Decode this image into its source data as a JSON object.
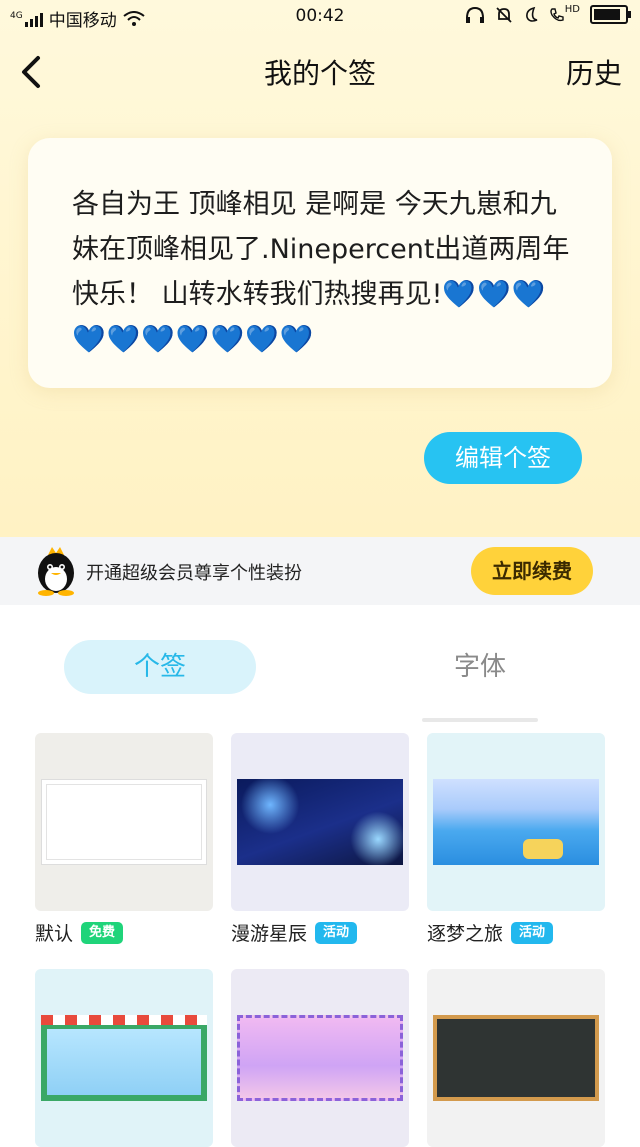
{
  "status_bar": {
    "signal_label": "4G",
    "carrier": "中国移动",
    "time": "00:42",
    "hd_label": "HD"
  },
  "nav": {
    "title": "我的个签",
    "history_label": "历史"
  },
  "signature": {
    "text": "各自为王 顶峰相见 是啊是 今天九崽和九妹在顶峰相见了.Ninepercent出道两周年快乐！ 山转水转我们热搜再见!",
    "hearts": "💙💙💙💙💙💙💙💙💙💙"
  },
  "edit_button_label": "编辑个签",
  "vip": {
    "text": "开通超级会员尊享个性装扮",
    "renew_label": "立即续费"
  },
  "tabs": [
    {
      "label": "个签",
      "active": true
    },
    {
      "label": "字体",
      "active": false
    }
  ],
  "templates": [
    {
      "name": "默认",
      "badge": "免费",
      "badge_type": "free"
    },
    {
      "name": "漫游星辰",
      "badge": "活动",
      "badge_type": "event"
    },
    {
      "name": "逐梦之旅",
      "badge": "活动",
      "badge_type": "event"
    },
    {
      "name": "",
      "badge": "",
      "badge_type": ""
    },
    {
      "name": "",
      "badge": "",
      "badge_type": ""
    },
    {
      "name": "",
      "badge": "",
      "badge_type": ""
    }
  ],
  "colors": {
    "accent": "#27c3f2",
    "vip_button": "#ffd23a",
    "free_badge": "#1fd47a",
    "event_badge": "#22b8ee"
  }
}
